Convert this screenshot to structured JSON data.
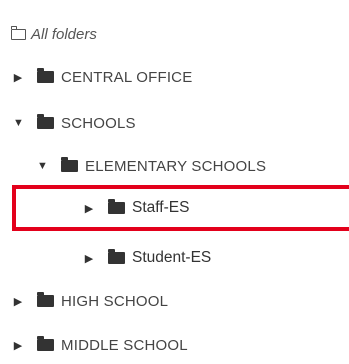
{
  "tree": {
    "root_label": "All folders",
    "items": [
      {
        "label": "CENTRAL OFFICE",
        "expanded": false
      },
      {
        "label": "SCHOOLS",
        "expanded": true
      },
      {
        "label": "ELEMENTARY SCHOOLS",
        "expanded": true
      },
      {
        "label": "Staff-ES",
        "expanded": false,
        "selected": true
      },
      {
        "label": "Student-ES",
        "expanded": false
      },
      {
        "label": "HIGH SCHOOL",
        "expanded": false
      },
      {
        "label": "MIDDLE SCHOOL",
        "expanded": false
      }
    ]
  },
  "colors": {
    "highlight": "#e3001b",
    "text": "#444444",
    "icon": "#333333"
  },
  "icons": {
    "root": "folder-outline-icon",
    "folder": "folder-icon",
    "collapsed": "caret-right-icon",
    "expanded": "caret-down-icon"
  }
}
